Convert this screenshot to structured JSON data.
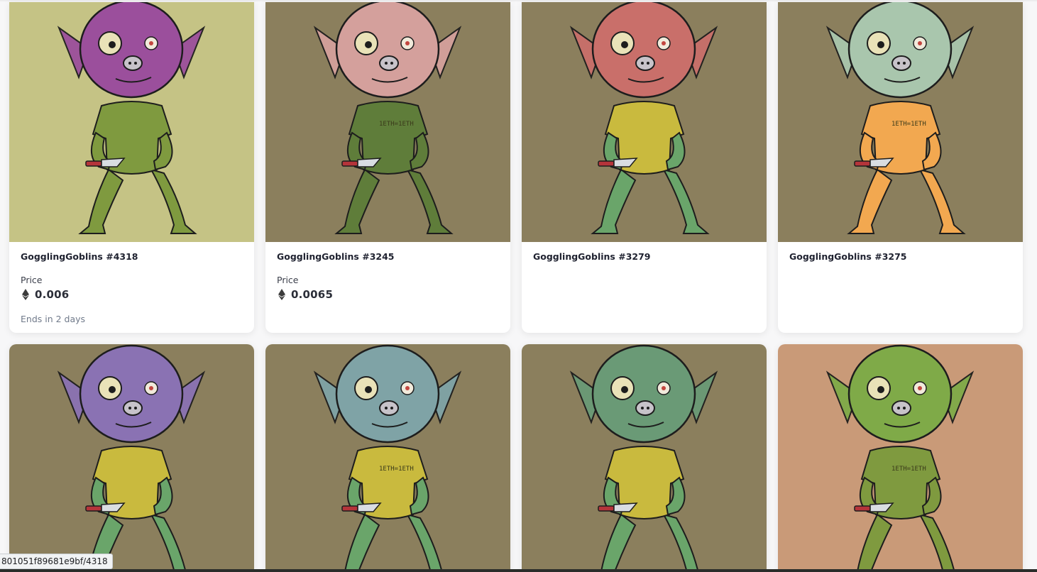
{
  "cards_row1": [
    {
      "name": "GogglingGoblins #4318",
      "price_label": "Price",
      "price": "0.006",
      "ends": "Ends in 2 days",
      "bg": "#c5c385",
      "head": "#9b4f9c",
      "body": "#7f9a3f",
      "shirt": "#7f9a3f"
    },
    {
      "name": "GogglingGoblins #3245",
      "price_label": "Price",
      "price": "0.0065",
      "ends": "",
      "bg": "#8b7f5d",
      "head": "#d4a09c",
      "body": "#5f7d3a",
      "shirt": "#5f7d3a"
    },
    {
      "name": "GogglingGoblins #3279",
      "price_label": "",
      "price": "",
      "ends": "",
      "bg": "#8b7f5d",
      "head": "#c96f6a",
      "body": "#6aa56a",
      "shirt": "#c9ba3e"
    },
    {
      "name": "GogglingGoblins #3275",
      "price_label": "",
      "price": "",
      "ends": "",
      "bg": "#8b7f5d",
      "head": "#a9c6ad",
      "body": "#f2a850",
      "shirt": "#f2a850"
    }
  ],
  "cards_row2": [
    {
      "bg": "#8b7f5d",
      "head": "#8a72b3",
      "body": "#6aa56a",
      "shirt": "#c9ba3e"
    },
    {
      "bg": "#8b7f5d",
      "head": "#7fa3a6",
      "body": "#6aa56a",
      "shirt": "#c9ba3e"
    },
    {
      "bg": "#8b7f5d",
      "head": "#6a9a76",
      "body": "#6aa56a",
      "shirt": "#c9ba3e"
    },
    {
      "bg": "#c99a78",
      "head": "#7faa48",
      "body": "#7f9a3f",
      "shirt": "#7f9a3f"
    }
  ],
  "status_url": "801051f89681e9bf/4318",
  "icons": {
    "currency": "ethereum-icon"
  }
}
